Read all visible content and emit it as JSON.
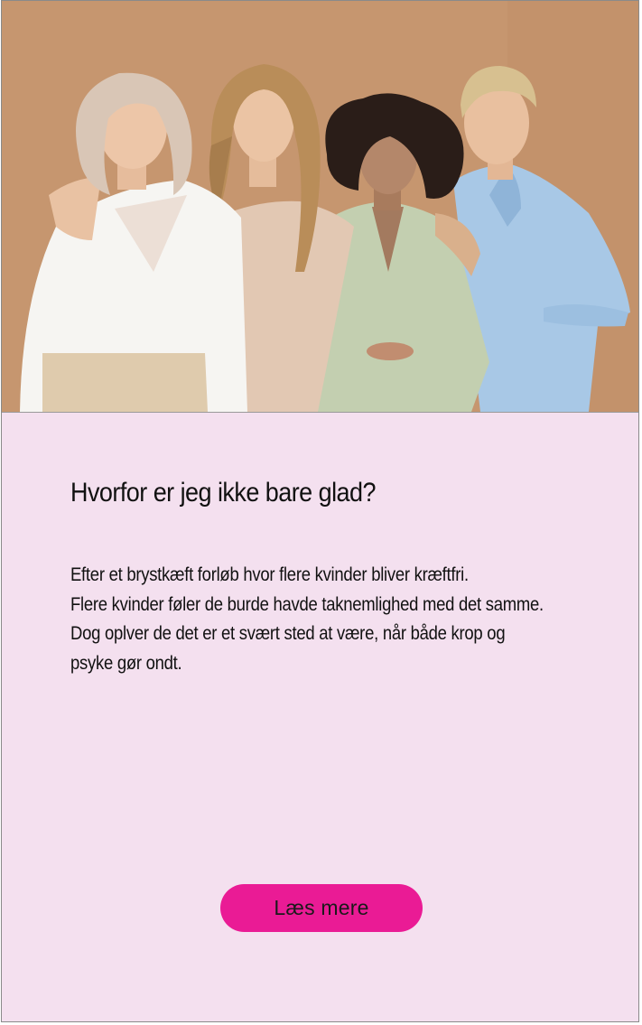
{
  "hero": {
    "image_alt": "Fire kvinder i forskellige aldre står tæt sammen foran en beige baggrund"
  },
  "article": {
    "title": "Hvorfor er jeg ikke bare glad?",
    "body_lines": [
      "Efter et brystkæft forløb hvor flere kvinder bliver kræftfri.",
      "Flere kvinder føler de burde havde taknemlighed med det samme.",
      "Dog oplver de det er et svært sted at være, når både krop og",
      "psyke gør ondt."
    ],
    "cta_label": "Læs mere"
  },
  "colors": {
    "background": "#f4e0ef",
    "accent": "#ea1b95",
    "photo_backdrop": "#c5936e"
  }
}
